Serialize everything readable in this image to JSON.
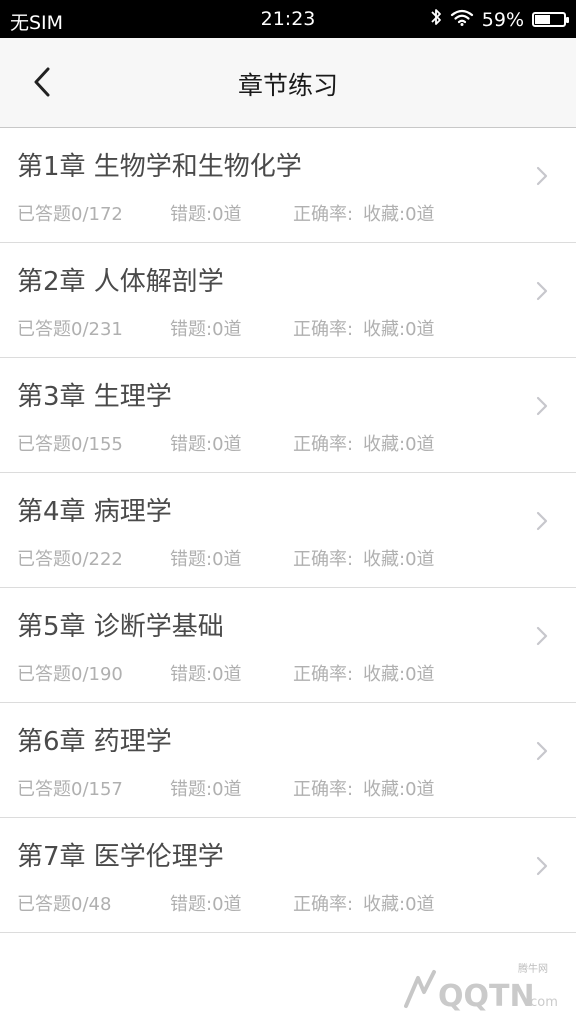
{
  "status": {
    "carrier": "无SIM",
    "time": "21:23",
    "battery_label": "59%",
    "battery_level": 0.59
  },
  "nav": {
    "title": "章节练习"
  },
  "chapters": [
    {
      "title": "第1章 生物学和生物化学",
      "answered": "已答题0/172",
      "wrong": "错题:0道",
      "accuracy": "正确率:",
      "favorites": "收藏:0道"
    },
    {
      "title": "第2章 人体解剖学",
      "answered": "已答题0/231",
      "wrong": "错题:0道",
      "accuracy": "正确率:",
      "favorites": "收藏:0道"
    },
    {
      "title": "第3章 生理学",
      "answered": "已答题0/155",
      "wrong": "错题:0道",
      "accuracy": "正确率:",
      "favorites": "收藏:0道"
    },
    {
      "title": "第4章 病理学",
      "answered": "已答题0/222",
      "wrong": "错题:0道",
      "accuracy": "正确率:",
      "favorites": "收藏:0道"
    },
    {
      "title": "第5章 诊断学基础",
      "answered": "已答题0/190",
      "wrong": "错题:0道",
      "accuracy": "正确率:",
      "favorites": "收藏:0道"
    },
    {
      "title": "第6章 药理学",
      "answered": "已答题0/157",
      "wrong": "错题:0道",
      "accuracy": "正确率:",
      "favorites": "收藏:0道"
    },
    {
      "title": "第7章 医学伦理学",
      "answered": "已答题0/48",
      "wrong": "错题:0道",
      "accuracy": "正确率:",
      "favorites": "收藏:0道"
    }
  ],
  "watermark": {
    "small_text": "腾牛网",
    "brand": "QQTN",
    "suffix": ".com"
  }
}
